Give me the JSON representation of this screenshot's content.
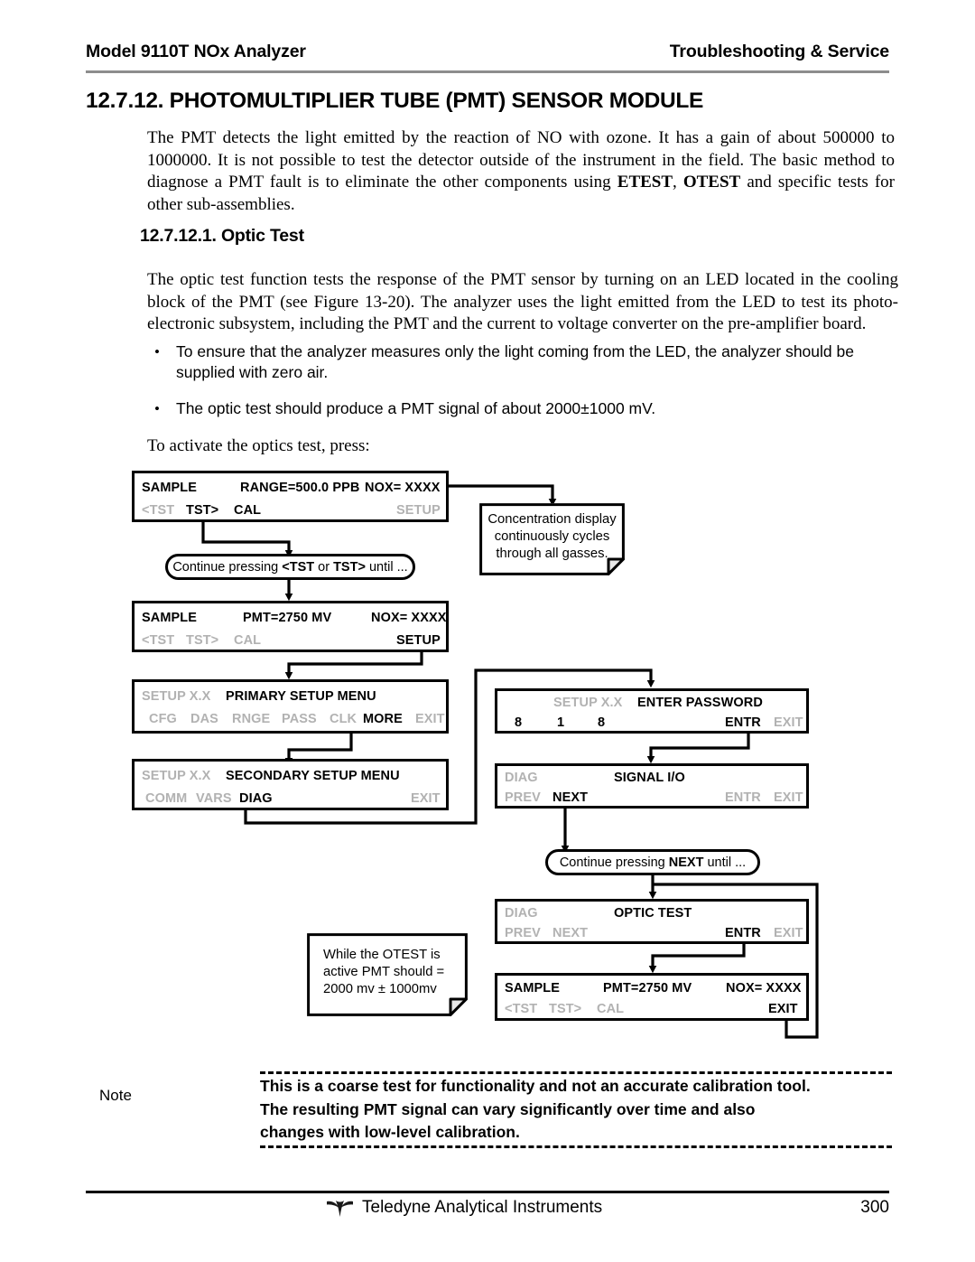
{
  "header": {
    "left": "Model 9110T NOx Analyzer",
    "right": "Troubleshooting & Service"
  },
  "headings": {
    "section": "12.7.12. PHOTOMULTIPLIER TUBE (PMT) SENSOR MODULE",
    "subsection": "12.7.12.1. Optic Test"
  },
  "paragraphs": {
    "intro_a": "The PMT detects the light emitted by the reaction of NO with ozone.  It has a gain of about 500000 to 1000000.  It is not possible to test the detector outside of the instrument in the field.  The basic method to diagnose a PMT fault is to eliminate the other components using ",
    "intro_etest": "ETEST",
    "intro_b": ", ",
    "intro_otest": "OTEST",
    "intro_c": " and specific tests for other sub-assemblies.",
    "optic": "The optic test function tests the response of the PMT sensor by turning on an LED located in the cooling block of the PMT (see Figure 13-20).  The analyzer uses the light emitted from the LED to test its photo-electronic subsystem, including the PMT and the current to voltage converter on the pre-amplifier board.",
    "activate": "To activate the optics test, press:"
  },
  "bullets": [
    {
      "marker": "•",
      "text": "To ensure that the analyzer measures only the light coming from the LED, the analyzer should be supplied with zero air."
    },
    {
      "marker": "•",
      "text": "The optic test should produce a PMT signal of about 2000±1000 mV."
    }
  ],
  "flow": {
    "panels": [
      {
        "id": "sample-range",
        "row1": [
          {
            "text": "SAMPLE",
            "state": "on"
          },
          {
            "text": "RANGE=500.0 PPB",
            "state": "on"
          },
          {
            "text": "NOX= XXXX",
            "state": "on"
          }
        ],
        "row2": [
          {
            "text": "<TST",
            "state": "dim"
          },
          {
            "text": "TST>",
            "state": "on"
          },
          {
            "text": "CAL",
            "state": "on"
          },
          {
            "text": "SETUP",
            "state": "dim"
          }
        ]
      },
      {
        "id": "sample-pmt-1",
        "row1": [
          {
            "text": "SAMPLE",
            "state": "on"
          },
          {
            "text": "PMT=2750 MV",
            "state": "on"
          },
          {
            "text": "NOX= XXXX",
            "state": "on"
          }
        ],
        "row2": [
          {
            "text": "<TST",
            "state": "dim"
          },
          {
            "text": "TST>",
            "state": "dim"
          },
          {
            "text": "CAL",
            "state": "dim"
          },
          {
            "text": "SETUP",
            "state": "on"
          }
        ]
      },
      {
        "id": "primary-setup-menu",
        "row1": [
          {
            "text": "SETUP X.X",
            "state": "dim"
          },
          {
            "text": "PRIMARY SETUP MENU",
            "state": "on"
          }
        ],
        "row2": [
          {
            "text": "CFG",
            "state": "dim"
          },
          {
            "text": "DAS",
            "state": "dim"
          },
          {
            "text": "RNGE",
            "state": "dim"
          },
          {
            "text": "PASS",
            "state": "dim"
          },
          {
            "text": "CLK",
            "state": "dim"
          },
          {
            "text": "MORE",
            "state": "on"
          },
          {
            "text": "EXIT",
            "state": "dim"
          }
        ]
      },
      {
        "id": "secondary-setup-menu",
        "row1": [
          {
            "text": "SETUP X.X",
            "state": "dim"
          },
          {
            "text": "SECONDARY SETUP MENU",
            "state": "on"
          }
        ],
        "row2": [
          {
            "text": "COMM",
            "state": "dim"
          },
          {
            "text": "VARS",
            "state": "dim"
          },
          {
            "text": "DIAG",
            "state": "on"
          },
          {
            "text": "EXIT",
            "state": "dim"
          }
        ]
      },
      {
        "id": "enter-password",
        "row1": [
          {
            "text": "SETUP X.X",
            "state": "dim"
          },
          {
            "text": "ENTER PASSWORD",
            "state": "on"
          }
        ],
        "row2": [
          {
            "text": "8",
            "state": "on"
          },
          {
            "text": "1",
            "state": "on"
          },
          {
            "text": "8",
            "state": "on"
          },
          {
            "text": "ENTR",
            "state": "on"
          },
          {
            "text": "EXIT",
            "state": "dim"
          }
        ]
      },
      {
        "id": "signal-io",
        "row1": [
          {
            "text": "DIAG",
            "state": "dim"
          },
          {
            "text": "SIGNAL I/O",
            "state": "on"
          }
        ],
        "row2": [
          {
            "text": "PREV",
            "state": "dim"
          },
          {
            "text": "NEXT",
            "state": "on"
          },
          {
            "text": "ENTR",
            "state": "dim"
          },
          {
            "text": "EXIT",
            "state": "dim"
          }
        ]
      },
      {
        "id": "optic-test",
        "row1": [
          {
            "text": "DIAG",
            "state": "dim"
          },
          {
            "text": "OPTIC TEST",
            "state": "on"
          }
        ],
        "row2": [
          {
            "text": "PREV",
            "state": "dim"
          },
          {
            "text": "NEXT",
            "state": "dim"
          },
          {
            "text": "ENTR",
            "state": "on"
          },
          {
            "text": "EXIT",
            "state": "dim"
          }
        ]
      },
      {
        "id": "sample-pmt-2",
        "row1": [
          {
            "text": "SAMPLE",
            "state": "on"
          },
          {
            "text": "PMT=2750 MV",
            "state": "on"
          },
          {
            "text": "NOX= XXXX",
            "state": "on"
          }
        ],
        "row2": [
          {
            "text": "<TST",
            "state": "dim"
          },
          {
            "text": "TST>",
            "state": "dim"
          },
          {
            "text": "CAL",
            "state": "dim"
          },
          {
            "text": "EXIT",
            "state": "on"
          }
        ]
      }
    ],
    "pills": [
      {
        "id": "continue-tst",
        "pre": "Continue pressing ",
        "key1": "<TST",
        "mid": " or ",
        "key2": "TST>",
        "post": " until ..."
      },
      {
        "id": "continue-next",
        "pre": "Continue pressing ",
        "key1": "NEXT",
        "mid": "",
        "key2": "",
        "post": " until ..."
      }
    ],
    "notes": [
      {
        "id": "concentration-note",
        "lines": [
          "Concentration display",
          "continuously cycles",
          "through all gasses."
        ]
      },
      {
        "id": "otest-note",
        "lines": [
          "While the OTEST is",
          "active PMT should =",
          "2000 mv ± 1000mv"
        ]
      }
    ]
  },
  "note_block": {
    "label": "Note",
    "lines": [
      "This is a coarse test for functionality and not an accurate calibration tool.",
      "The resulting PMT signal can vary significantly over time and also",
      "changes with low-level calibration."
    ]
  },
  "footer": {
    "company": "Teledyne Analytical Instruments",
    "page_number": "300"
  }
}
